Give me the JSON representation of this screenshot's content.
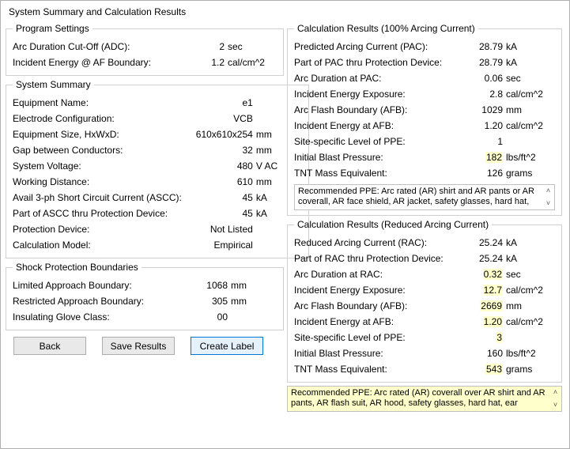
{
  "window": {
    "title": "System Summary and Calculation Results"
  },
  "program_settings": {
    "legend": "Program Settings",
    "adc_label": "Arc Duration Cut-Off (ADC):",
    "adc_value": "2",
    "adc_unit": "sec",
    "ie_label": "Incident Energy @ AF Boundary:",
    "ie_value": "1.2",
    "ie_unit": "cal/cm^2"
  },
  "system_summary": {
    "legend": "System Summary",
    "equip_name_label": "Equipment Name:",
    "equip_name_value": "e1",
    "electrode_label": "Electrode Configuration:",
    "electrode_value": "VCB",
    "size_label": "Equipment Size, HxWxD:",
    "size_value": "610x610x254",
    "size_unit": "mm",
    "gap_label": "Gap between Conductors:",
    "gap_value": "32",
    "gap_unit": "mm",
    "voltage_label": "System Voltage:",
    "voltage_value": "480",
    "voltage_unit": "V AC",
    "workdist_label": "Working Distance:",
    "workdist_value": "610",
    "workdist_unit": "mm",
    "ascc_label": "Avail 3-ph Short Circuit Current (ASCC):",
    "ascc_value": "45",
    "ascc_unit": "kA",
    "ascc_prot_label": "Part of ASCC thru Protection Device:",
    "ascc_prot_value": "45",
    "ascc_prot_unit": "kA",
    "protdev_label": "Protection Device:",
    "protdev_value": "Not Listed",
    "calcmodel_label": "Calculation Model:",
    "calcmodel_value": "Empirical"
  },
  "shock": {
    "legend": "Shock Protection Boundaries",
    "lab_label": "Limited Approach Boundary:",
    "lab_value": "1068",
    "lab_unit": "mm",
    "rab_label": "Restricted Approach Boundary:",
    "rab_value": "305",
    "rab_unit": "mm",
    "glove_label": "Insulating Glove Class:",
    "glove_value": "00"
  },
  "calc100": {
    "legend": "Calculation Results (100% Arcing Current)",
    "pac_label": "Predicted Arcing Current (PAC):",
    "pac_value": "28.79",
    "pac_unit": "kA",
    "pacprot_label": "Part of PAC thru Protection Device:",
    "pacprot_value": "28.79",
    "pacprot_unit": "kA",
    "arcdur_label": "Arc Duration at PAC:",
    "arcdur_value": "0.06",
    "arcdur_unit": "sec",
    "ieexp_label": "Incident Energy Exposure:",
    "ieexp_value": "2.8",
    "ieexp_unit": "cal/cm^2",
    "afb_label": "Arc Flash Boundary (AFB):",
    "afb_value": "1029",
    "afb_unit": "mm",
    "ieafb_label": "Incident Energy at AFB:",
    "ieafb_value": "1.20",
    "ieafb_unit": "cal/cm^2",
    "ppe_label": "Site-specific Level of PPE:",
    "ppe_value": "1",
    "blast_label": "Initial Blast Pressure:",
    "blast_value": "182",
    "blast_unit": "lbs/ft^2",
    "tnt_label": "TNT Mass Equivalent:",
    "tnt_value": "126",
    "tnt_unit": "grams",
    "ppe_text": "Recommended PPE: Arc rated (AR) shirt and AR pants or AR coverall, AR face shield, AR jacket, safety glasses, hard hat,"
  },
  "calcRed": {
    "legend": "Calculation Results (Reduced  Arcing Current)",
    "rac_label": "Reduced Arcing Current (RAC):",
    "rac_value": "25.24",
    "rac_unit": "kA",
    "racprot_label": "Part of RAC thru Protection Device:",
    "racprot_value": "25.24",
    "racprot_unit": "kA",
    "arcdur_label": "Arc Duration at RAC:",
    "arcdur_value": "0.32",
    "arcdur_unit": "sec",
    "ieexp_label": "Incident Energy Exposure:",
    "ieexp_value": "12.7",
    "ieexp_unit": "cal/cm^2",
    "afb_label": "Arc Flash Boundary (AFB):",
    "afb_value": "2669",
    "afb_unit": "mm",
    "ieafb_label": "Incident Energy at AFB:",
    "ieafb_value": "1.20",
    "ieafb_unit": "cal/cm^2",
    "ppe_label": "Site-specific Level of PPE:",
    "ppe_value": "3",
    "blast_label": "Initial Blast Pressure:",
    "blast_value": "160",
    "blast_unit": "lbs/ft^2",
    "tnt_label": "TNT Mass Equivalent:",
    "tnt_value": "543",
    "tnt_unit": "grams",
    "ppe_text": "Recommended PPE: Arc rated (AR) coverall over AR shirt and AR pants, AR flash suit, AR hood, safety glasses, hard hat, ear"
  },
  "buttons": {
    "back": "Back",
    "save": "Save Results",
    "create": "Create Label"
  },
  "glyphs": {
    "up": "˄",
    "down": "˅"
  }
}
